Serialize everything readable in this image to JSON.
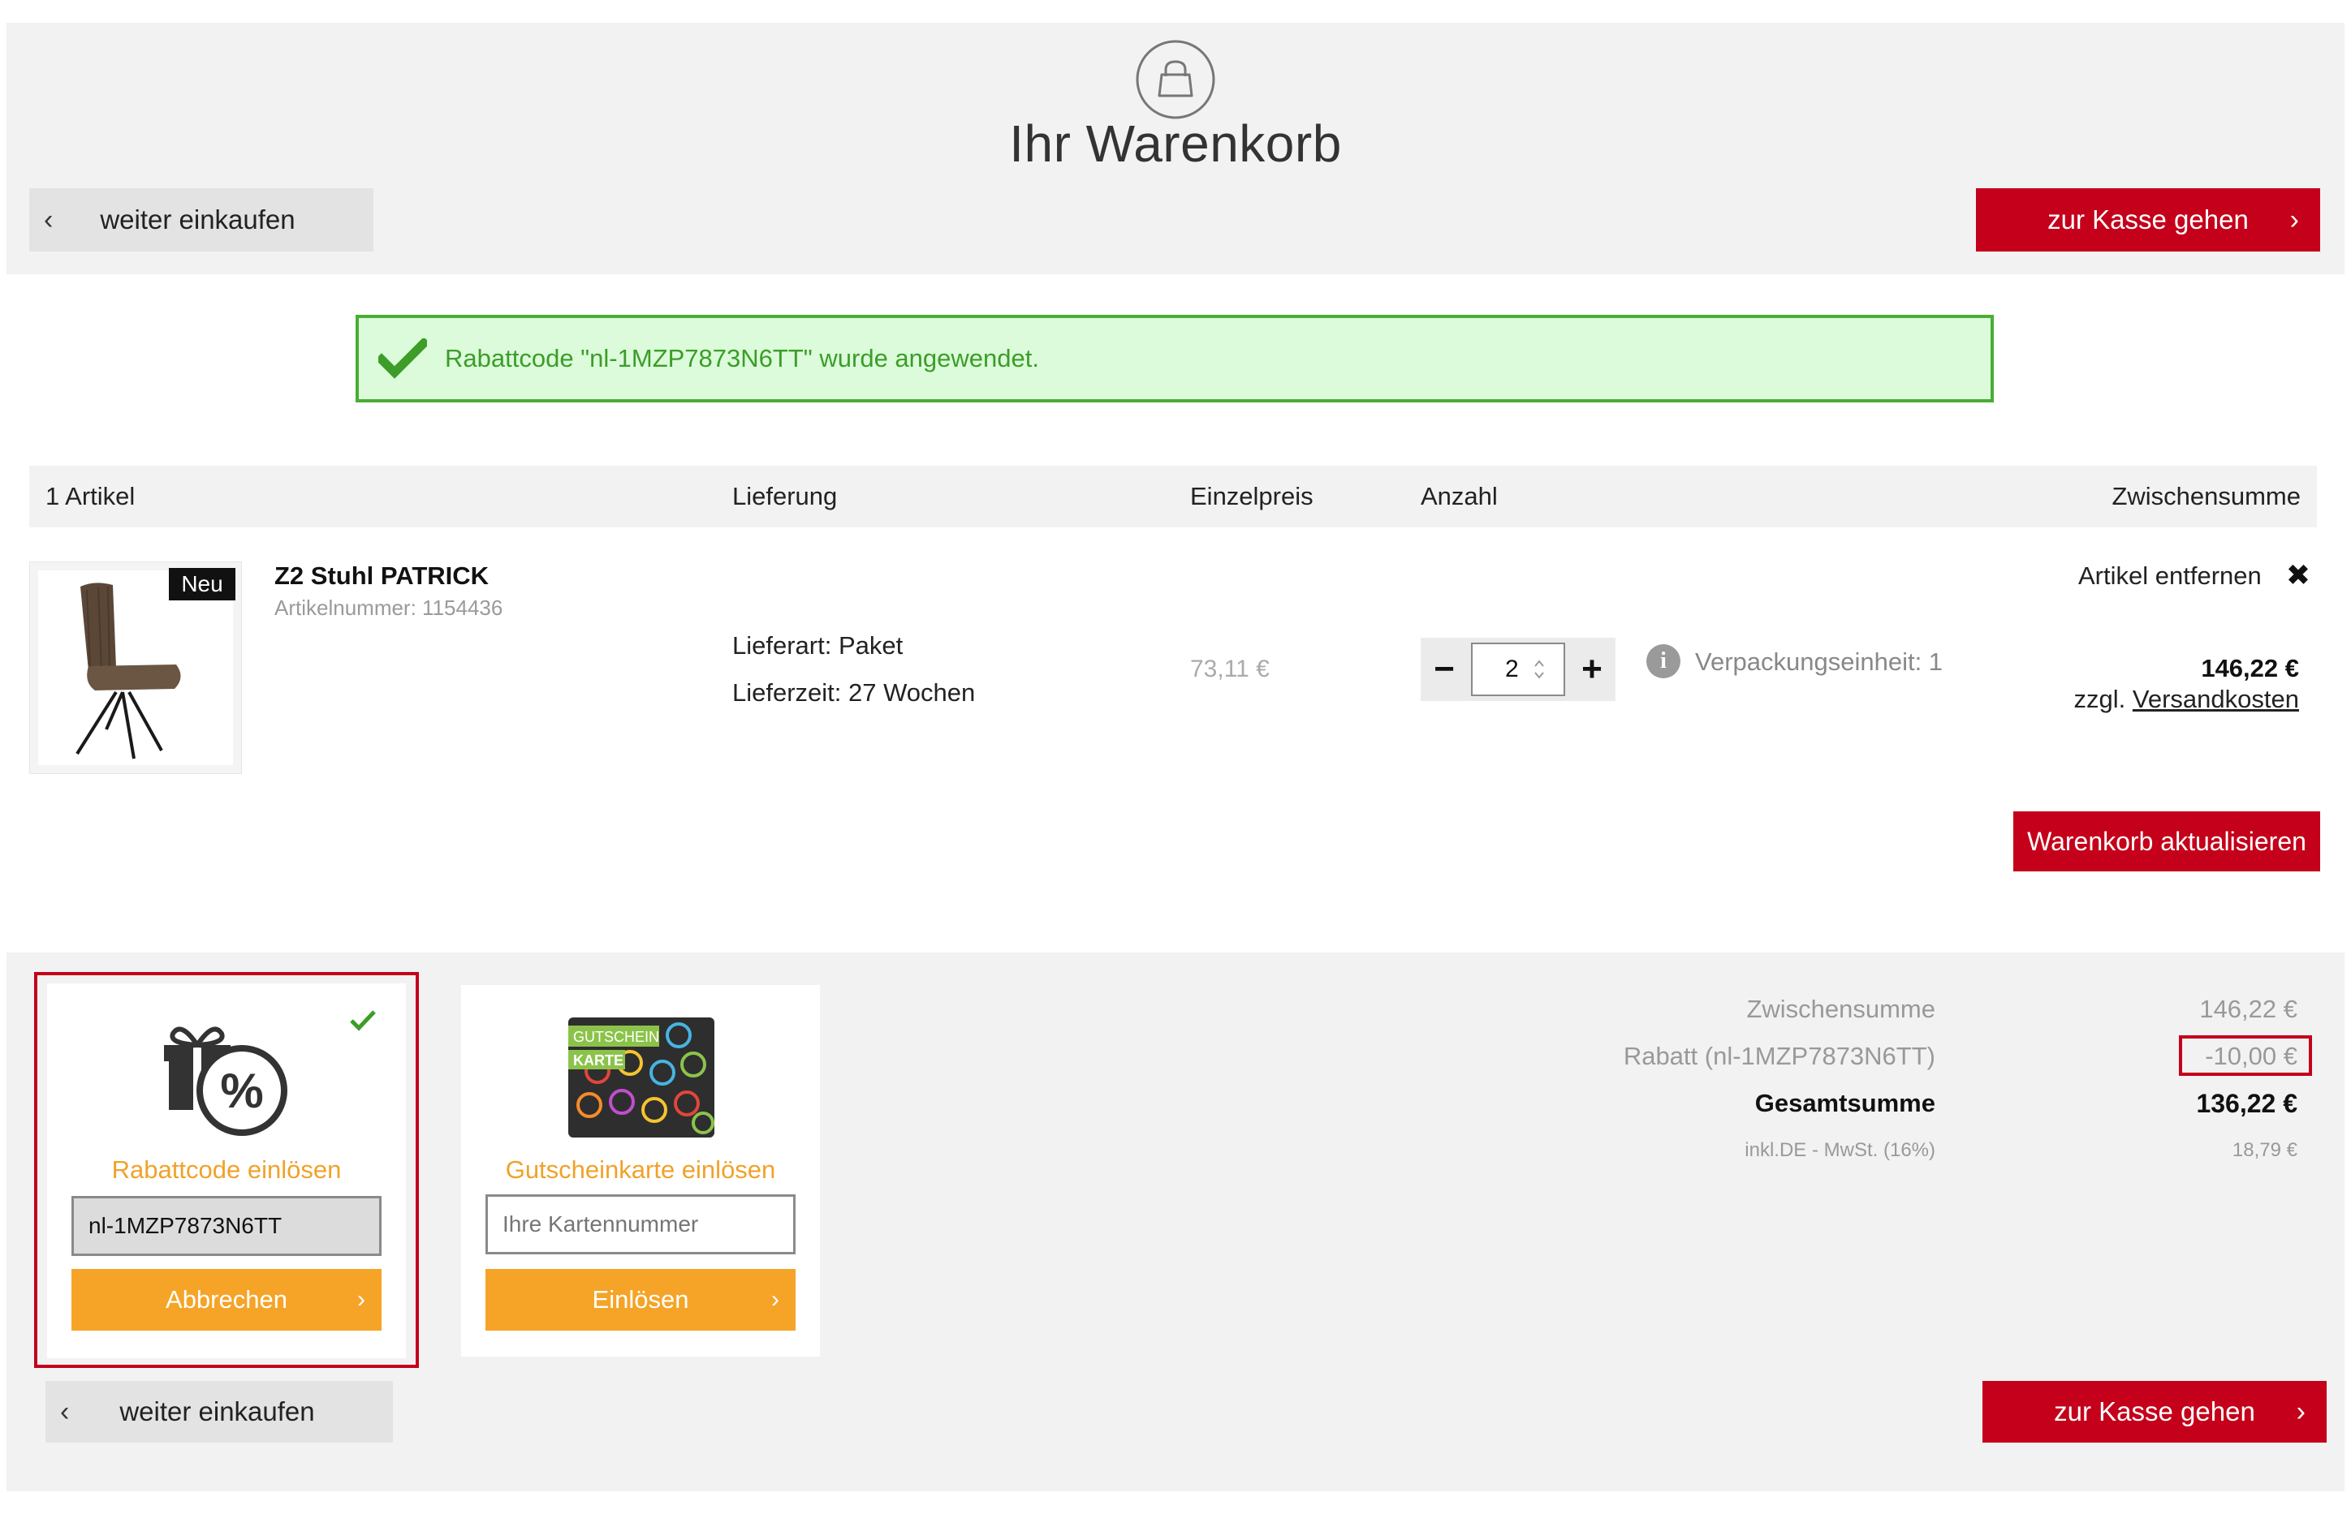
{
  "header": {
    "title": "Ihr Warenkorb",
    "continue_label": "weiter einkaufen",
    "checkout_label": "zur Kasse gehen"
  },
  "alert": {
    "message": "Rabattcode \"nl-1MZP7873N6TT\" wurde angewendet."
  },
  "table": {
    "columns": [
      "1 Artikel",
      "Lieferung",
      "Einzelpreis",
      "Anzahl",
      "Zwischensumme"
    ]
  },
  "item": {
    "badge": "Neu",
    "name": "Z2 Stuhl PATRICK",
    "sku": "Artikelnummer: 1154436",
    "delivery_type": "Lieferart: Paket",
    "delivery_time": "Lieferzeit: 27 Wochen",
    "unit_price": "73,11 €",
    "quantity": "2",
    "packaging_unit": "Verpackungseinheit: 1",
    "remove_label": "Artikel entfernen",
    "subtotal": "146,22 €",
    "shipping_prefix": "zzgl.",
    "shipping_link": "Versandkosten"
  },
  "update_button": "Warenkorb aktualisieren",
  "coupon": {
    "title": "Rabattcode einlösen",
    "value": "nl-1MZP7873N6TT",
    "button": "Abbrechen"
  },
  "giftcard": {
    "title": "Gutscheinkarte einlösen",
    "placeholder": "Ihre Kartennummer",
    "button": "Einlösen",
    "card_line1": "GUTSCHEIN",
    "card_line2": "KARTE"
  },
  "summary": {
    "subtotal_label": "Zwischensumme",
    "subtotal_value": "146,22 €",
    "discount_label": "Rabatt (nl-1MZP7873N6TT)",
    "discount_value": "-10,00 €",
    "total_label": "Gesamtsumme",
    "total_value": "136,22 €",
    "tax_label": "inkl.DE - MwSt. (16%)",
    "tax_value": "18,79 €"
  },
  "footer": {
    "continue_label": "weiter einkaufen",
    "checkout_label": "zur Kasse gehen"
  },
  "colors": {
    "brand_red": "#c4001a",
    "accent_orange": "#f5a428",
    "success_green": "#4aad35",
    "success_bg": "#dbfbdb"
  },
  "icons": {
    "header": "shopping-bag-icon",
    "alert": "checkmark-icon",
    "info": "info-icon",
    "remove": "close-icon",
    "coupon": "gift-percent-icon",
    "giftcard": "gift-card-icon"
  }
}
